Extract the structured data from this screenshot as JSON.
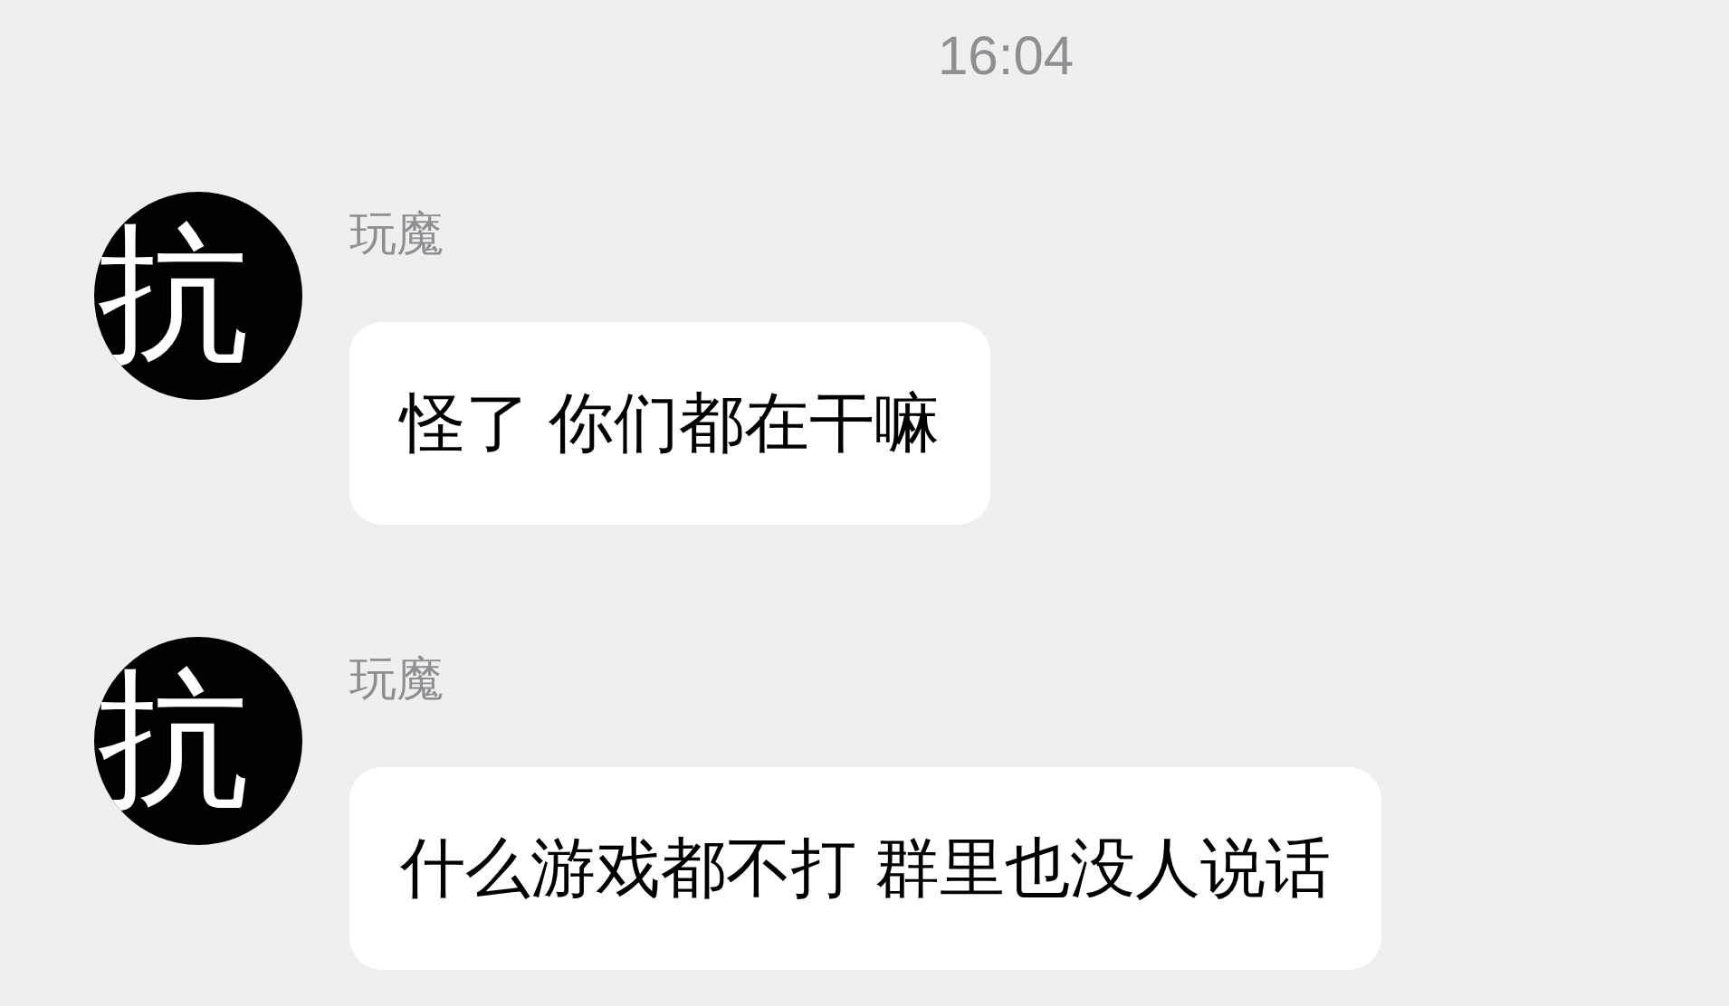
{
  "timestamp": "16:04",
  "messages": [
    {
      "sender": "玩魔",
      "avatar_text": "抗",
      "text": "怪了 你们都在干嘛"
    },
    {
      "sender": "玩魔",
      "avatar_text": "抗",
      "text": "什么游戏都不打 群里也没人说话"
    }
  ]
}
